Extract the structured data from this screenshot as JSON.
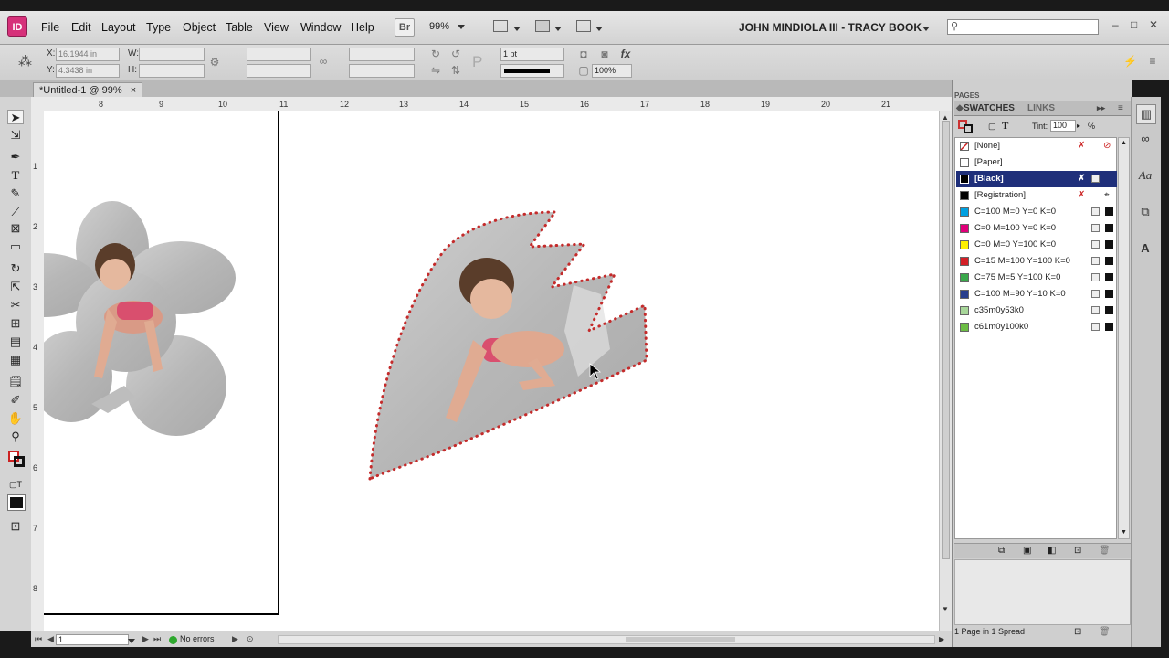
{
  "app": {
    "logo": "ID",
    "menus": [
      "File",
      "Edit",
      "Layout",
      "Type",
      "Object",
      "Table",
      "View",
      "Window",
      "Help"
    ],
    "bridge_label": "Br",
    "zoom": "99%",
    "document_title": "JOHN MINDIOLA III - TRACY BOOK"
  },
  "control": {
    "x_label": "X:",
    "x_value": "16.1944 in",
    "y_label": "Y:",
    "y_value": "4.3438 in",
    "w_label": "W:",
    "h_label": "H:",
    "stroke_weight": "1 pt",
    "opacity": "100%"
  },
  "tab": {
    "title": "*Untitled-1 @ 99%",
    "close": "×"
  },
  "ruler": {
    "h_ticks": [
      "8",
      "9",
      "10",
      "11",
      "12",
      "13",
      "14",
      "15",
      "16",
      "17",
      "18",
      "19",
      "20",
      "21"
    ],
    "v_ticks": [
      "1",
      "2",
      "3",
      "4",
      "5",
      "6",
      "7",
      "8"
    ]
  },
  "status": {
    "page": "1",
    "errors": "No errors"
  },
  "panel": {
    "tab_pages": "PAGES",
    "tab_swatches": "SWATCHES",
    "tab_links": "LINKS",
    "tint_label": "Tint:",
    "tint_value": "100",
    "tint_unit": "%",
    "swatches": [
      {
        "name": "[None]",
        "color": "#ffffff"
      },
      {
        "name": "[Paper]",
        "color": "#ffffff"
      },
      {
        "name": "[Black]",
        "color": "#000000"
      },
      {
        "name": "[Registration]",
        "color": "#000000"
      },
      {
        "name": "C=100 M=0 Y=0 K=0",
        "color": "#00a0e0"
      },
      {
        "name": "C=0 M=100 Y=0 K=0",
        "color": "#e0007a"
      },
      {
        "name": "C=0 M=0 Y=100 K=0",
        "color": "#fff000"
      },
      {
        "name": "C=15 M=100 Y=100 K=0",
        "color": "#d42027"
      },
      {
        "name": "C=75 M=5 Y=100 K=0",
        "color": "#3aa84b"
      },
      {
        "name": "C=100 M=90 Y=10 K=0",
        "color": "#283e8c"
      },
      {
        "name": "c35m0y53k0",
        "color": "#a8d79a"
      },
      {
        "name": "c61m0y100k0",
        "color": "#6cbd45"
      }
    ],
    "pages_info": "1 Page in 1 Spread"
  }
}
